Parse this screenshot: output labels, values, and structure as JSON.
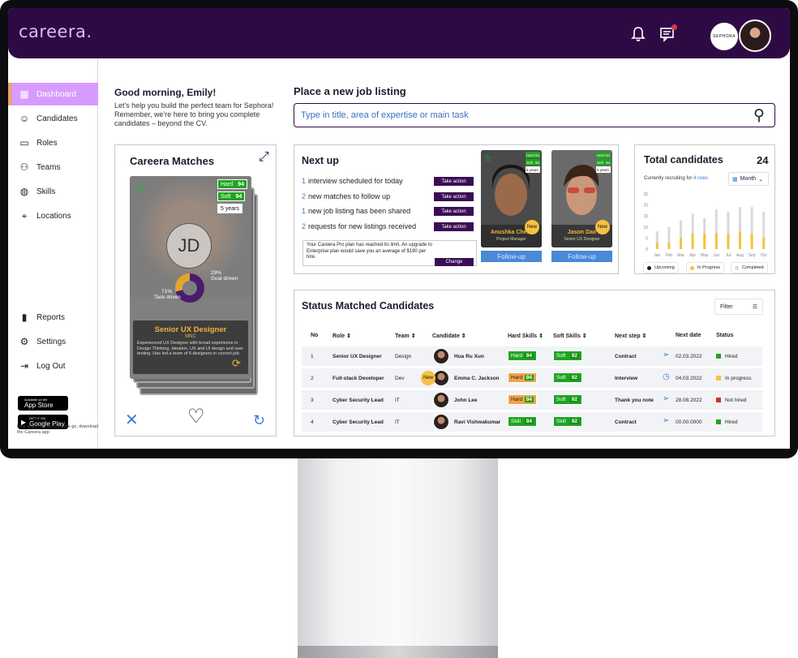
{
  "app": {
    "logo": "careera."
  },
  "header": {
    "brand_label": "SEPHORA"
  },
  "sidebar": {
    "items": [
      {
        "label": "Dashboard",
        "icon": "grid-icon"
      },
      {
        "label": "Candidates",
        "icon": "user-icon"
      },
      {
        "label": "Roles",
        "icon": "briefcase-icon"
      },
      {
        "label": "Teams",
        "icon": "team-icon"
      },
      {
        "label": "Skills",
        "icon": "globe-icon"
      },
      {
        "label": "Locations",
        "icon": "pin-icon"
      }
    ],
    "bottom_items": [
      {
        "label": "Reports",
        "icon": "bar-chart-icon"
      },
      {
        "label": "Settings",
        "icon": "gear-icon"
      },
      {
        "label": "Log Out",
        "icon": "logout-icon"
      }
    ],
    "app_store": {
      "top": "Available on the",
      "main": "App Store"
    },
    "google_play": {
      "top": "GET IT ON",
      "main": "Google Play"
    },
    "note": "Find team members on the go, download the Careera app"
  },
  "greeting": {
    "title": "Good morning, Emily!",
    "text": "Let's help you build the perfect team for Sephora! Remember, we're here to bring you complete candidates – beyond the CV."
  },
  "matches": {
    "title": "Careera Matches",
    "card": {
      "initials": "JD",
      "hard_label": "Hard",
      "hard_score": "94",
      "soft_label": "Soft",
      "soft_score": "94",
      "experience": "5 years",
      "goal_pct": "29%",
      "goal_label": "Goal driven",
      "task_pct": "71%",
      "task_label": "Task driven",
      "role": "Senior UX Designer",
      "company": "MNC",
      "description": "Experienced UX Designer with broad experience in Design Thinking, Ideation, UX and UI design and user testing. Has led a team of 6 designers in current job."
    },
    "task_driven_fraction": 0.71
  },
  "search": {
    "title": "Place a new job listing",
    "placeholder": "Type in title, area of expertise or main task"
  },
  "next_up": {
    "title": "Next up",
    "rows": [
      {
        "count": "1",
        "text": "interview scheduled for today",
        "action": "Take action"
      },
      {
        "count": "2",
        "text": "new matches to follow up",
        "action": "Take action"
      },
      {
        "count": "1",
        "text": "new job listing has been shared",
        "action": "Take action"
      },
      {
        "count": "2",
        "text": "requests for new listings received",
        "action": "Take action"
      }
    ],
    "pro_notice": "Your Careera Pro plan has reached its limit. An upgrade to Enterprise plan would save you an average of $190 per hire.",
    "change_label": "Change",
    "candidates": [
      {
        "name": "Anushka Chetti",
        "role": "Project Manager",
        "badge": "New",
        "hard": "94",
        "soft": "94",
        "years": "5 years",
        "follow": "Follow-up"
      },
      {
        "name": "Jason Dao",
        "role": "Senior UX Designer",
        "badge": "New",
        "hard": "94",
        "soft": "94",
        "years": "5 years",
        "follow": "Follow-up"
      }
    ]
  },
  "total": {
    "title": "Total candidates",
    "count": "24",
    "sub_prefix": "Currently recruiting for",
    "sub_link": "4 roles",
    "period": "Month",
    "legend": [
      "Upcoming",
      "In Progress",
      "Completed"
    ],
    "colors": {
      "upcoming": "#1f1b2e",
      "in_progress": "#f5c242",
      "completed": "#d9d9d9"
    }
  },
  "chart_data": {
    "type": "bar",
    "categories": [
      "Jan",
      "Feb",
      "Mar",
      "Apr",
      "May",
      "Jun",
      "Jul",
      "Aug",
      "Sep",
      "Oct"
    ],
    "ylim": [
      0,
      25
    ],
    "yticks": [
      "0",
      "5",
      "10",
      "15",
      "20",
      "25"
    ],
    "series": [
      {
        "name": "Upcoming",
        "values": [
          0,
          0,
          0,
          0,
          0,
          0,
          0,
          0,
          0,
          0
        ]
      },
      {
        "name": "In Progress",
        "values": [
          3,
          3,
          5,
          7,
          7,
          7,
          7,
          8,
          7,
          5
        ]
      },
      {
        "name": "Completed",
        "values": [
          8,
          10,
          13,
          16,
          14,
          18,
          17,
          19,
          19,
          17
        ]
      }
    ]
  },
  "status_table": {
    "title": "Status Matched Candidates",
    "filter_label": "Filter",
    "headers": [
      "No",
      "Role",
      "Team",
      "Candidate",
      "Hard Skills",
      "Soft Skills",
      "Next step",
      "Next date",
      "Status"
    ],
    "rows": [
      {
        "no": "1",
        "role": "Senior UX Designer",
        "team": "Design",
        "candidate": "Hua Ru Xun",
        "hard_label": "Hard",
        "hard": "94",
        "hard_color": "green",
        "soft_label": "Soft",
        "soft": "92",
        "next_step": "Contract",
        "next_date": "02.03.2022",
        "status": "Hired",
        "status_color": "#1fa421"
      },
      {
        "no": "2",
        "role": "Full-stack Developer",
        "team": "Dev",
        "candidate": "Emma C. Jackson",
        "badge": "New",
        "hard_label": "Hard",
        "hard": "94",
        "hard_color": "orange",
        "soft_label": "Soft",
        "soft": "92",
        "next_step": "Interview",
        "next_date": "04.03.2022",
        "status": "In progress",
        "status_color": "#f5c242"
      },
      {
        "no": "3",
        "role": "Cyber Security Lead",
        "team": "IT",
        "candidate": "John Lee",
        "hard_label": "Hard",
        "hard": "94",
        "hard_color": "orange",
        "soft_label": "Soft",
        "soft": "92",
        "next_step": "Thank you note",
        "next_date": "28.08.2022",
        "status": "Not hired",
        "status_color": "#d0312d"
      },
      {
        "no": "4",
        "role": "Cyber Security Lead",
        "team": "IT",
        "candidate": "Ravi Vishwakumar",
        "hard_label": "Skill",
        "hard": "94",
        "hard_color": "green",
        "soft_label": "Skill",
        "soft": "92",
        "next_step": "Contract",
        "next_date": "00.00.0000",
        "status": "Hired",
        "status_color": "#1fa421"
      }
    ]
  }
}
